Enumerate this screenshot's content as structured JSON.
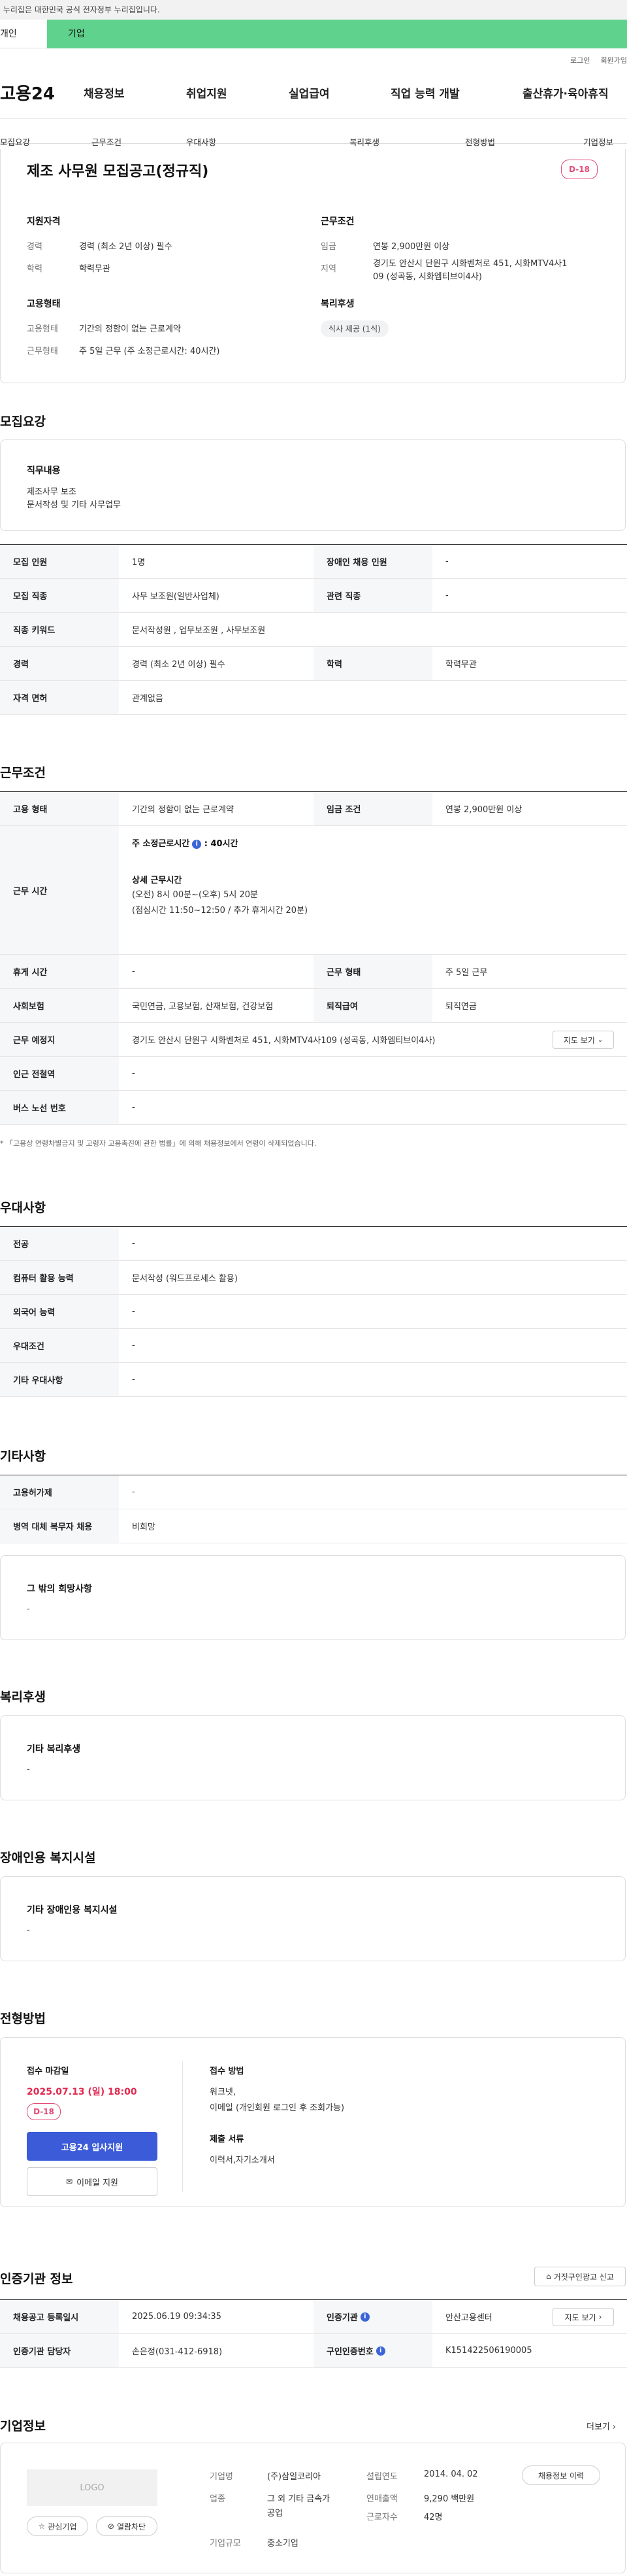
{
  "gov_banner": "이 누리집은 대한민국 공식 전자정부 누리집입니다.",
  "tabs": {
    "individual": "개인",
    "corporate": "기업"
  },
  "util": {
    "login": "로그인",
    "signup": "회원가입"
  },
  "logo": "고용24",
  "gnb": [
    "채용정보",
    "취업지원",
    "실업급여",
    "직업 능력 개발",
    "출산휴가·육아휴직"
  ],
  "subnav": [
    "모집요강",
    "근무조건",
    "우대사항",
    "복리후생",
    "전형방법",
    "기업정보"
  ],
  "job": {
    "title": "제조 사무원 모집공고(정규직)",
    "dday": "D-18",
    "qual_title": "지원자격",
    "career_l": "경력",
    "career_v": "경력 (최소 2년 이상) 필수",
    "edu_l": "학력",
    "edu_v": "학력무관",
    "cond_title": "근무조건",
    "wage_l": "임금",
    "wage_v": "연봉 2,900만원 이상",
    "region_l": "지역",
    "region_v1": "경기도 안산시 단원구 시화벤처로 451, 시화MTV4사1",
    "region_v2": "09 (성곡동, 시화엠티브이4사)",
    "emp_title": "고용형태",
    "emp_l": "고용형태",
    "emp_v": "기간의 정함이 없는 근로계약",
    "work_l": "근무형태",
    "work_v": "주 5일 근무 (주 소정근로시간: 40시간)",
    "welfare_title": "복리후생",
    "welfare_tag": "식사 제공 (1식)"
  },
  "recruit": {
    "title": "모집요강",
    "duty_title": "직무내용",
    "duty_1": "제조사무 보조",
    "duty_2": "문서작성 및 기타 사무업무",
    "rows": [
      {
        "l1": "모집 인원",
        "v1": "1명",
        "l2": "장애인 채용 인원",
        "v2": "-"
      },
      {
        "l1": "모집 직종",
        "v1": "사무 보조원(일반사업체)",
        "l2": "관련 직종",
        "v2": "-"
      },
      {
        "l1": "직종 키워드",
        "v1": "문서작성원 , 업무보조원 , 사무보조원"
      },
      {
        "l1": "경력",
        "v1": "경력 (최소 2년 이상) 필수",
        "l2": "학력",
        "v2": "학력무관"
      },
      {
        "l1": "자격 면허",
        "v1": "관계없음"
      }
    ]
  },
  "work": {
    "title": "근무조건",
    "emp_l": "고용 형태",
    "emp_v": "기간의 정함이 없는 근로계약",
    "wage_l": "임금 조건",
    "wage_v": "연봉 2,900만원 이상",
    "time_l": "근무 시간",
    "time_week": "주 소정근로시간",
    "time_week_v": ": 40시간",
    "time_detail": "상세 근무시간",
    "time_1": "(오전) 8시 00분~(오후) 5시 20분",
    "time_2": "(점심시간 11:50~12:50 / 추가 휴게시간 20분)",
    "rest_l": "휴게 시간",
    "rest_v": "-",
    "form_l": "근무 형태",
    "form_v": "주 5일 근무",
    "ins_l": "사회보험",
    "ins_v": "국민연금, 고용보험, 산재보험, 건강보험",
    "sev_l": "퇴직급여",
    "sev_v": "퇴직연금",
    "place_l": "근무 예정지",
    "place_v": "경기도 안산시 단원구 시화벤처로 451, 시화MTV4사109 (성곡동, 시화엠티브이4사)",
    "map_btn": "지도 보기",
    "station_l": "인근 전철역",
    "station_v": "-",
    "bus_l": "버스 노선 번호",
    "bus_v": "-",
    "notice": "* 「고용상 연령차별금지 및 고령자 고용촉진에 관한 법률」에 의해 채용정보에서 연령이 삭제되었습니다."
  },
  "pref": {
    "title": "우대사항",
    "rows": [
      [
        "전공",
        "-"
      ],
      [
        "컴퓨터 활용 능력",
        "문서작성 (워드프로세스 활용)"
      ],
      [
        "외국어 능력",
        "-"
      ],
      [
        "우대조건",
        "-"
      ],
      [
        "기타 우대사항",
        "-"
      ]
    ]
  },
  "etc": {
    "title": "기타사항",
    "rows": [
      [
        "고용허가제",
        "-"
      ],
      [
        "병역 대체 복무자 채용",
        "비희망"
      ]
    ],
    "hope_title": "그 밖의 희망사항",
    "hope_v": "-"
  },
  "welfare": {
    "title": "복리후생",
    "item_title": "기타 복리후생",
    "item_v": "-"
  },
  "disabled": {
    "title": "장애인용 복지시설",
    "item_title": "기타 장애인용 복지시설",
    "item_v": "-"
  },
  "selection": {
    "title": "전형방법",
    "deadline_title": "접수 마감일",
    "deadline": "2025.07.13 (일) 18:00",
    "dday": "D-18",
    "apply_btn": "고용24 입사지원",
    "email_btn": "이메일 지원",
    "method_title": "접수 방법",
    "method_1": "워크넷,",
    "method_2": "이메일 (개인회원 로그인 후 조회가능)",
    "docs_title": "제출 서류",
    "docs_v": "이력서,자기소개서"
  },
  "cert": {
    "title": "인증기관 정보",
    "report_btn": "거짓구인광고 신고",
    "reg_l": "채용공고 등록일시",
    "reg_v": "2025.06.19 09:34:35",
    "org_l": "인증기관",
    "org_v": "안산고용센터",
    "map_btn": "지도 보기",
    "mgr_l": "인증기관 담당자",
    "mgr_v": "손은정(031-412-6918)",
    "num_l": "구인인증번호",
    "num_v": "K151422506190005"
  },
  "company": {
    "title": "기업정보",
    "more": "더보기",
    "logo": "LOGO",
    "fav_btn": "관심기업",
    "block_btn": "열람차단",
    "name_l": "기업명",
    "name_v": "(주)삼일코리아",
    "year_l": "설립연도",
    "year_v": "2014. 04. 02",
    "hist_btn": "채용정보 이력",
    "ind_l": "업종",
    "ind_v1": "그 외 기타 금속가",
    "ind_v2": "공업",
    "sales_l": "연매출액",
    "sales_v": "9,290 백만원",
    "emp_l": "근로자수",
    "emp_v": "42명",
    "size_l": "기업규모",
    "size_v": "중소기업"
  }
}
